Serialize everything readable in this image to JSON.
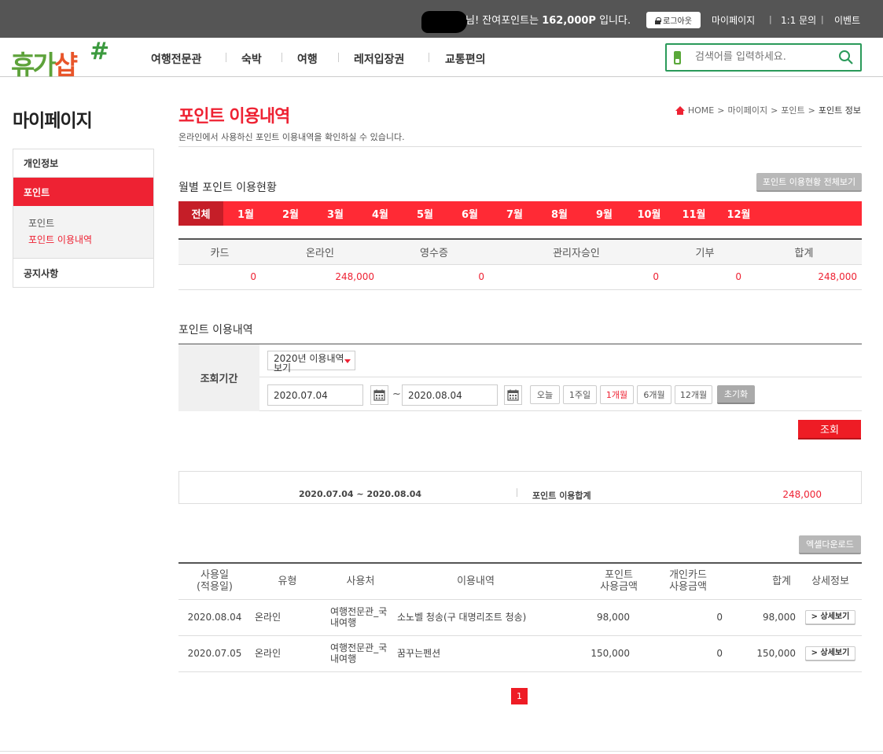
{
  "topbar": {
    "greeting_pre": "님! 잔여포인트는 ",
    "points": "162,000P",
    "greeting_post": " 입니다.",
    "logout": "로그아웃",
    "links": [
      "마이페이지",
      "1:1 문의",
      "이벤트"
    ],
    "separator": "|"
  },
  "logo": {
    "text_a": "휴가",
    "text_b": "샵",
    "mark": "#"
  },
  "gnb": [
    "여행전문관",
    "숙박",
    "여행",
    "레저입장권",
    "교통편의"
  ],
  "search": {
    "placeholder": "검색어를 입력하세요."
  },
  "sidebar": {
    "title": "마이페이지",
    "items": [
      {
        "label": "개인정보"
      },
      {
        "label": "포인트"
      },
      {
        "label": "공지사항"
      }
    ],
    "sub_items": [
      {
        "label": "포인트"
      },
      {
        "label": "포인트 이용내역"
      }
    ]
  },
  "page": {
    "title": "포인트 이용내역",
    "description": "온라인에서 사용하신 포인트 이용내역을 확인하실 수 있습니다.",
    "breadcrumb": [
      "HOME",
      "마이페이지",
      "포인트",
      "포인트 정보"
    ],
    "crumb_sep": ">"
  },
  "monthly": {
    "title": "월별 포인트 이용현황",
    "view_all_button": "포인트 이용현황 전체보기",
    "tabs": [
      "전체",
      "1월",
      "2월",
      "3월",
      "4월",
      "5월",
      "6월",
      "7월",
      "8월",
      "9월",
      "10월",
      "11월",
      "12월"
    ],
    "active_tab": "전체",
    "headers": [
      "카드",
      "온라인",
      "영수증",
      "관리자승인",
      "기부",
      "합계"
    ],
    "values": [
      "0",
      "248,000",
      "0",
      "0",
      "0",
      "248,000"
    ]
  },
  "history": {
    "title": "포인트 이용내역",
    "period_label": "조회기간",
    "year_select": "2020년 이용내역 보기",
    "date_from": "2020.07.04",
    "date_to": "2020.08.04",
    "tilde": "~",
    "period_buttons": [
      "오늘",
      "1주일",
      "1개월",
      "6개월",
      "12개월"
    ],
    "active_period": "1개월",
    "reset": "초기화",
    "query": "조회"
  },
  "total": {
    "period": "2020.07.04 ~ 2020.08.04",
    "label": "포인트 이용합계",
    "value": "248,000"
  },
  "excel_button": "엑셀다운로드",
  "list": {
    "headers": [
      {
        "line1": "사용일",
        "line2": "(적용일)"
      },
      {
        "line1": "유형",
        "line2": ""
      },
      {
        "line1": "사용처",
        "line2": ""
      },
      {
        "line1": "이용내역",
        "line2": ""
      },
      {
        "line1": "포인트",
        "line2": "사용금액"
      },
      {
        "line1": "개인카드",
        "line2": "사용금액"
      },
      {
        "line1": "합계",
        "line2": ""
      },
      {
        "line1": "상세정보",
        "line2": ""
      }
    ],
    "rows": [
      {
        "date": "2020.08.04",
        "type": "온라인",
        "place": "여행전문관_국내여행",
        "desc": "소노벨 청송(구 대명리조트 청송)",
        "point": "98,000",
        "card": "0",
        "total": "98,000",
        "detail": "상세보기"
      },
      {
        "date": "2020.07.05",
        "type": "온라인",
        "place": "여행전문관_국내여행",
        "desc": "꿈꾸는펜션",
        "point": "150,000",
        "card": "0",
        "total": "150,000",
        "detail": "상세보기"
      }
    ]
  },
  "pagination": {
    "current": "1"
  },
  "colors": {
    "accent": "#ee2233",
    "brand_green": "#5da23a",
    "topbar": "#555555"
  }
}
